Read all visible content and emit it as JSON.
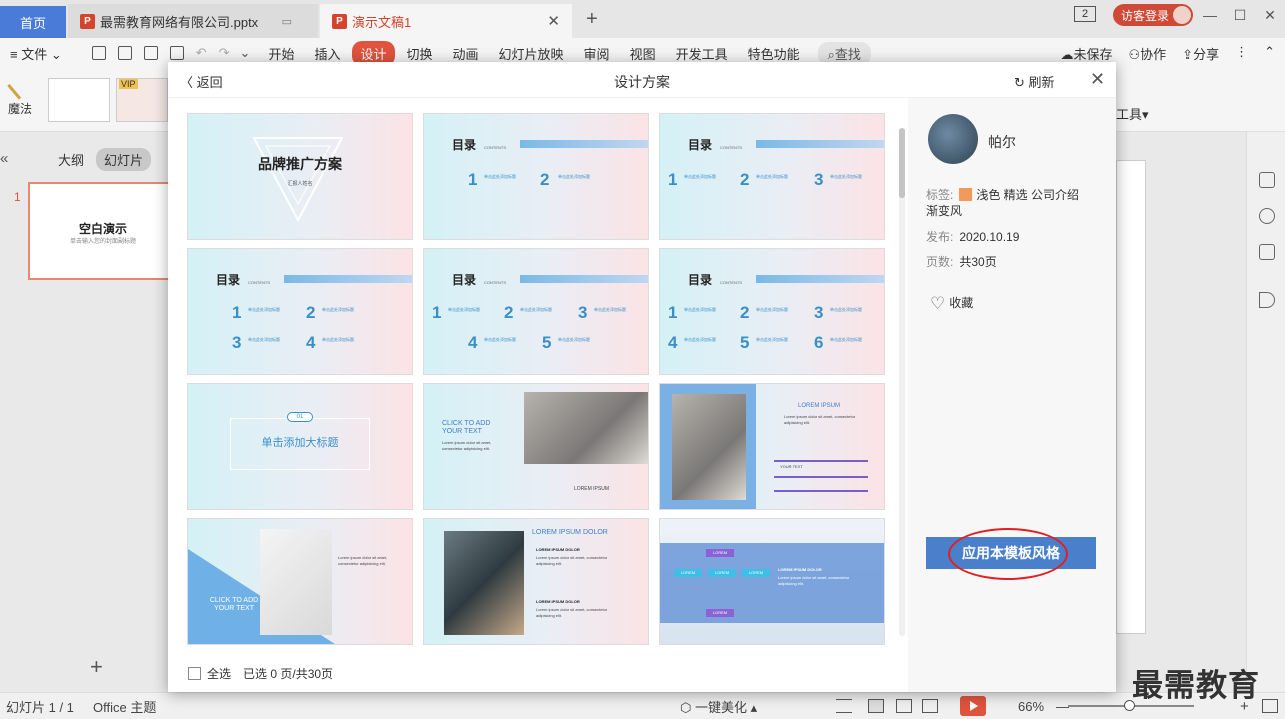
{
  "tabs": {
    "home": "首页",
    "pptx": "最需教育网络有限公司.pptx",
    "doc": "演示文稿1",
    "count_badge": "2",
    "login": "访客登录"
  },
  "menu": {
    "file": "文件",
    "items": [
      "开始",
      "插入",
      "设计",
      "切换",
      "动画",
      "幻灯片放映",
      "审阅",
      "视图",
      "开发工具",
      "特色功能"
    ],
    "search": "查找",
    "unsaved": "未保存",
    "collab": "协作",
    "share": "分享"
  },
  "ribbon": {
    "magic": "魔法",
    "tools": "工具",
    "vip": "VIP"
  },
  "leftpanel": {
    "outline": "大纲",
    "slides": "幻灯片",
    "slide_index": "1",
    "slide_title": "空白演示",
    "slide_subtitle": "单击输入您的封面副标题"
  },
  "modal": {
    "back": "返回",
    "title": "设计方案",
    "refresh": "刷新",
    "select_all": "全选",
    "selected": "已选 0 页/共30页"
  },
  "side": {
    "author": "帕尔",
    "tags_label": "标签:",
    "tags_value": "浅色 精选 公司介绍",
    "tags_value2": "渐变风",
    "published_label": "发布:",
    "published_value": "2020.10.19",
    "pages_label": "页数:",
    "pages_value": "共30页",
    "favorite": "收藏",
    "apply": "应用本模板风格"
  },
  "cards": {
    "cover_title": "品牌推广方案",
    "cover_sub": "汇报人姓名",
    "toc": "目录",
    "toc_en": "CONTENTS",
    "toc_item": "单击此处添加标题",
    "section_title": "单击添加大标题",
    "section_num": "01",
    "click_add": "CLICK TO ADD YOUR TEXT",
    "lorem": "LOREM IPSUM",
    "lorem_dolor": "LOREM IPSUM DOLOR",
    "your_text": "YOUR TEXT",
    "lorem_small": "LOREM",
    "body": "Lorem ipsum dolor sit amet, consectetur adipisicing elit."
  },
  "status": {
    "slide": "幻灯片 1 / 1",
    "theme": "Office 主题",
    "beautify": "一键美化",
    "zoom": "66%"
  },
  "watermark": "最需教育",
  "colors": {
    "accent": "#e0533d",
    "apply_button": "#4a7fcb",
    "highlight_ring": "#e02121",
    "home_tab": "#4a7bd9"
  }
}
